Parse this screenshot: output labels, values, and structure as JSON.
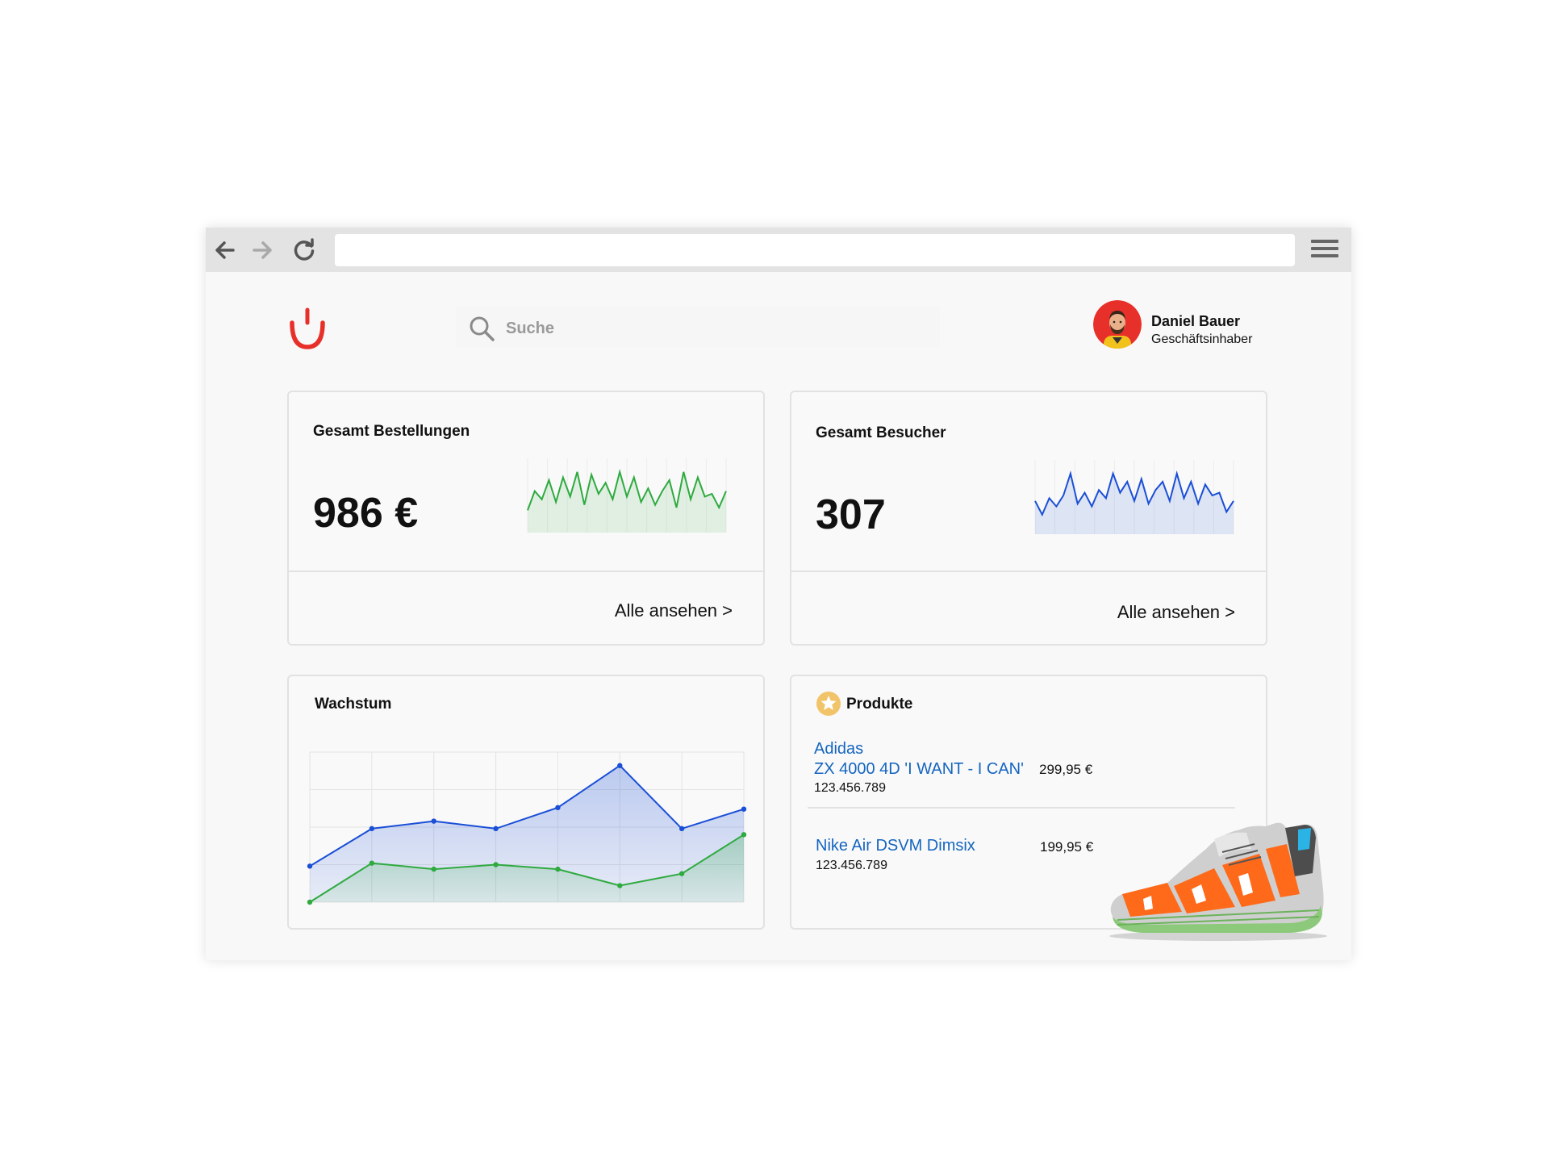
{
  "browser": {
    "url": "",
    "back_icon": "arrow-left-icon",
    "forward_icon": "arrow-right-icon",
    "reload_icon": "reload-icon",
    "menu_icon": "hamburger-menu-icon"
  },
  "header": {
    "logo_icon": "smile-logo-icon",
    "logo_color": "#e8302a",
    "search": {
      "placeholder": "Suche",
      "value": "",
      "icon": "search-icon"
    },
    "user": {
      "name": "Daniel Bauer",
      "role": "Geschäftsinhaber",
      "avatar_bg": "#e8302a"
    }
  },
  "cards": {
    "orders": {
      "title": "Gesamt Bestellungen",
      "value": "986 €",
      "link": "Alle ansehen >",
      "color": "#2eaa3f",
      "sparkline": [
        0.2,
        0.55,
        0.4,
        0.75,
        0.35,
        0.8,
        0.45,
        0.9,
        0.3,
        0.85,
        0.5,
        0.7,
        0.4,
        0.9,
        0.45,
        0.8,
        0.35,
        0.6,
        0.3,
        0.55,
        0.75,
        0.25,
        0.9,
        0.4,
        0.8,
        0.45,
        0.5,
        0.25,
        0.55
      ]
    },
    "visitors": {
      "title": "Gesamt Besucher",
      "value": "307",
      "link": "Alle ansehen >",
      "color": "#1a4fd6",
      "sparkline": [
        0.4,
        0.15,
        0.45,
        0.3,
        0.5,
        0.9,
        0.35,
        0.55,
        0.3,
        0.6,
        0.45,
        0.9,
        0.55,
        0.75,
        0.4,
        0.8,
        0.35,
        0.6,
        0.75,
        0.4,
        0.9,
        0.45,
        0.75,
        0.35,
        0.7,
        0.5,
        0.55,
        0.2,
        0.4
      ]
    },
    "growth": {
      "title": "Wachstum"
    },
    "products": {
      "title": "Produkte",
      "star_icon": "star-badge-icon",
      "items": [
        {
          "name_line1": "Adidas",
          "name_line2": "ZX 4000 4D 'I WANT - I CAN'",
          "price": "299,95 €",
          "sku": "123.456.789"
        },
        {
          "name_line1": "Nike Air DSVM Dimsix",
          "name_line2": "",
          "price": "199,95 €",
          "sku": "123.456.789"
        }
      ],
      "image_icon": "sneaker-image"
    }
  },
  "chart_data": {
    "type": "area",
    "x": [
      1,
      2,
      3,
      4,
      5,
      6,
      7,
      8
    ],
    "series": [
      {
        "color": "#1a4fd6",
        "values": [
          24,
          49,
          54,
          49,
          63,
          91,
          49,
          62
        ]
      },
      {
        "color": "#2eaa3f",
        "values": [
          0,
          26,
          22,
          25,
          22,
          11,
          19,
          45
        ]
      }
    ],
    "ylim": [
      0,
      100
    ],
    "grid": true
  }
}
